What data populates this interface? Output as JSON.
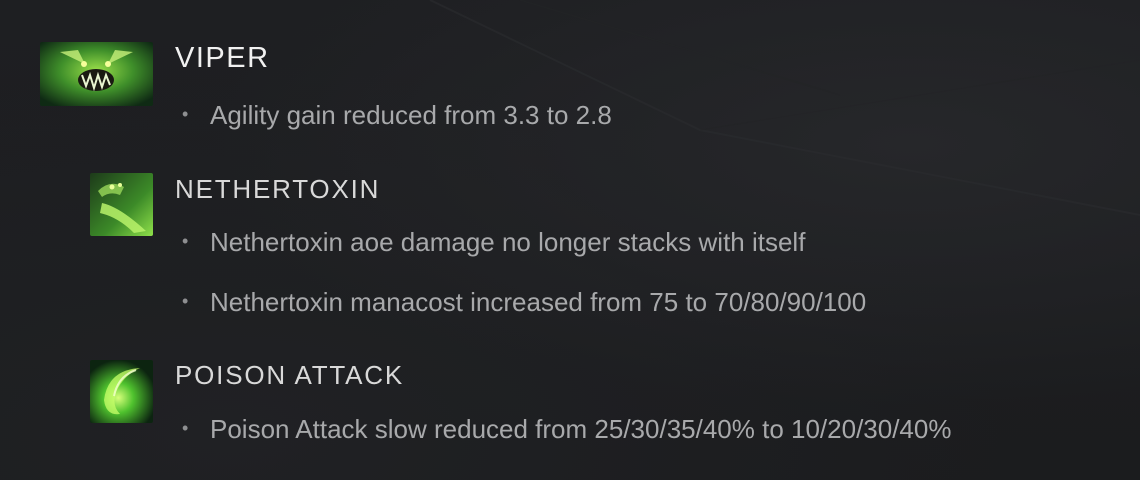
{
  "hero": {
    "name": "VIPER",
    "notes": [
      "Agility gain reduced from 3.3 to 2.8"
    ],
    "portrait_icon": "viper-portrait-icon"
  },
  "abilities": [
    {
      "name": "NETHERTOXIN",
      "icon": "nethertoxin-icon",
      "notes": [
        "Nethertoxin aoe damage no longer stacks with itself",
        "Nethertoxin manacost increased from 75 to 70/80/90/100"
      ]
    },
    {
      "name": "POISON ATTACK",
      "icon": "poison-attack-icon",
      "notes": [
        "Poison Attack slow reduced from 25/30/35/40% to 10/20/30/40%"
      ]
    }
  ],
  "bullet_glyph": "•",
  "colors": {
    "background": "#1d1e20",
    "hero_title": "#f1f1f1",
    "ability_title": "#d9d9d9",
    "note_text": "#a8a9ab",
    "icon_green": "#5fd33a"
  }
}
